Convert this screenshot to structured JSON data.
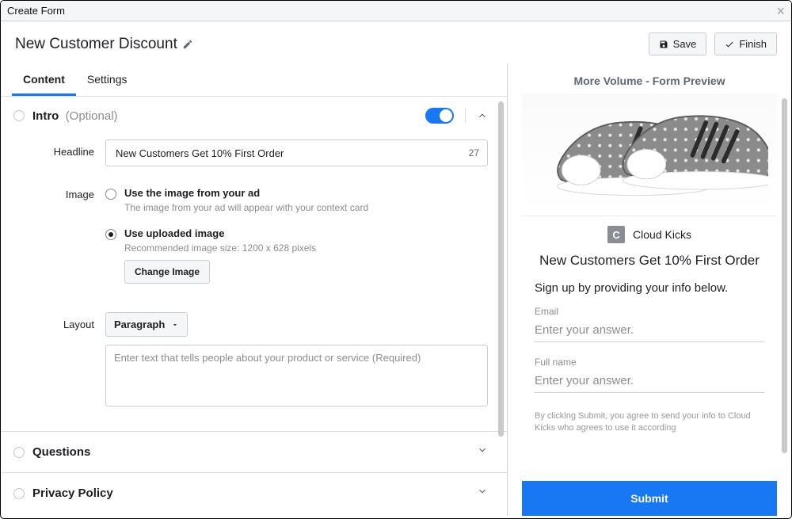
{
  "window": {
    "title": "Create Form"
  },
  "header": {
    "form_name": "New Customer Discount",
    "buttons": {
      "save": "Save",
      "finish": "Finish"
    }
  },
  "tabs": {
    "content": "Content",
    "settings": "Settings"
  },
  "intro": {
    "title": "Intro",
    "optional_label": "(Optional)",
    "headline_label": "Headline",
    "headline_value": "New Customers Get 10% First Order",
    "headline_count": "27",
    "image_label": "Image",
    "image_opt1_title": "Use the image from your ad",
    "image_opt1_sub": "The image from your ad will appear with your context card",
    "image_opt2_title": "Use uploaded image",
    "image_opt2_sub": "Recommended image size: 1200 x 628 pixels",
    "change_image_btn": "Change Image",
    "layout_label": "Layout",
    "layout_selected": "Paragraph",
    "layout_placeholder": "Enter text that tells people about your product or service (Required)"
  },
  "sections": {
    "questions": "Questions",
    "privacy": "Privacy Policy"
  },
  "preview": {
    "title": "More Volume - Form Preview",
    "brand_initial": "C",
    "brand_name": "Cloud Kicks",
    "headline": "New Customers Get 10% First Order",
    "subtext": "Sign up by providing your info below.",
    "fields": {
      "email_label": "Email",
      "email_placeholder": "Enter your answer.",
      "name_label": "Full name",
      "name_placeholder": "Enter your answer."
    },
    "legal": "By clicking Submit, you agree to send your info to Cloud Kicks who agrees to use it according",
    "submit": "Submit"
  }
}
